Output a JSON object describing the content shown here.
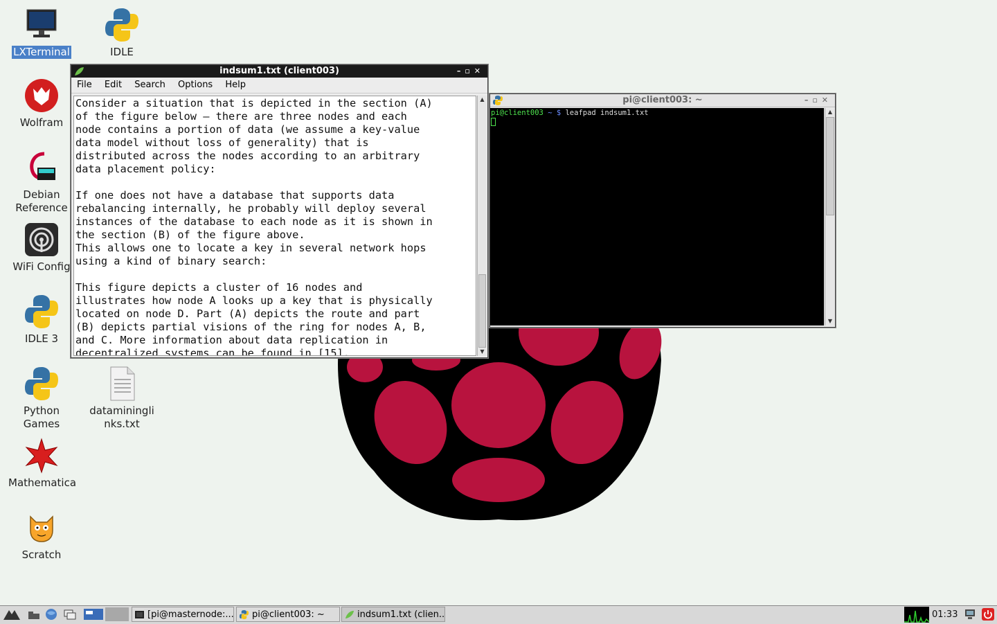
{
  "desktop": {
    "icons": [
      {
        "label": "LXTerminal",
        "selected": true
      },
      {
        "label": "IDLE"
      },
      {
        "label": "Wolfram"
      },
      {
        "label": "Debian\nReference"
      },
      {
        "label": "WiFi Config"
      },
      {
        "label": "IDLE 3"
      },
      {
        "label": "Python\nGames"
      },
      {
        "label": "dataminingli\nnks.txt"
      },
      {
        "label": "Mathematica"
      },
      {
        "label": "Scratch"
      }
    ]
  },
  "leafpad": {
    "title": "indsum1.txt (client003)",
    "menu": [
      "File",
      "Edit",
      "Search",
      "Options",
      "Help"
    ],
    "text": "Consider a situation that is depicted in the section (A)\nof the figure below – there are three nodes and each\nnode contains a portion of data (we assume a key-value\ndata model without loss of generality) that is\ndistributed across the nodes according to an arbitrary\ndata placement policy:\n\nIf one does not have a database that supports data\nrebalancing internally, he probably will deploy several\ninstances of the database to each node as it is shown in\nthe section (B) of the figure above.\nThis allows one to locate a key in several network hops\nusing a kind of binary search:\n\nThis figure depicts a cluster of 16 nodes and\nillustrates how node A looks up a key that is physically\nlocated on node D. Part (A) depicts the route and part\n(B) depicts partial visions of the ring for nodes A, B,\nand C. More information about data replication in\ndecentralized systems can be found in [15].",
    "scroll_fraction": 0.7
  },
  "terminal": {
    "title": "pi@client003: ~",
    "prompt_user": "pi@client003",
    "prompt_path": "~ $",
    "command": "leafpad indsum1.txt"
  },
  "taskbar": {
    "tasks": [
      {
        "label": "[pi@masternode:..."
      },
      {
        "label": "pi@client003: ~"
      },
      {
        "label": "indsum1.txt (clien..."
      }
    ],
    "clock": "01:33"
  },
  "colors": {
    "raspberry": "#b8133e",
    "desktop_bg": "#eef3ee",
    "selection": "#4a80c8"
  }
}
